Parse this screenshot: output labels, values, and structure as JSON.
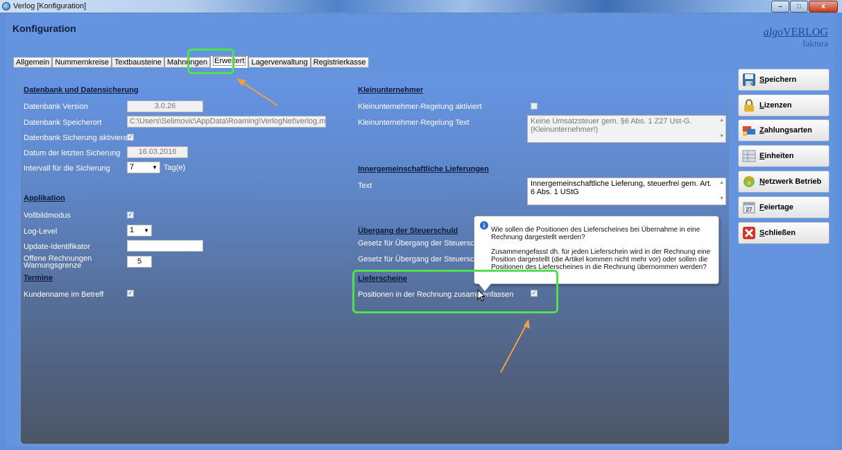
{
  "window": {
    "title": "Verlog [Konfiguration]",
    "min": "–",
    "max": "□",
    "close": "x"
  },
  "header": {
    "title": "Konfiguration",
    "brand_main": "algo",
    "brand_main2": "VERLOG",
    "brand_sub": "faktura"
  },
  "tabs": [
    "Allgemein",
    "Nummernkreise",
    "Textbausteine",
    "Mahnungen",
    "Erweitert",
    "Lagerverwaltung",
    "Registrierkasse"
  ],
  "left": {
    "db_section": "Datenbank und Datensicherung",
    "db_version_label": "Datenbank Version",
    "db_version_value": "3.0.26",
    "db_path_label": "Datenbank Speicherort",
    "db_path_value": "C:\\Users\\Selimovic\\AppData\\Roaming\\VerlogNet\\verlog.mdb",
    "backup_enable_label": "Datenbank Sicherung aktivieren",
    "last_backup_label": "Datum der letzten Sicherung",
    "last_backup_value": "16.03.2016",
    "interval_label": "Intervall für die Sicherung",
    "interval_value": "7",
    "interval_unit": "Tag(e)",
    "app_section": "Applikation",
    "fullscreen_label": "Vollbildmodus",
    "loglevel_label": "Log-Level",
    "loglevel_value": "1",
    "update_id_label": "Update-Identifikator",
    "update_id_value": "",
    "open_invoices_label_1": "Offene Rechnungen",
    "open_invoices_label_2": "Warnungsgrenze",
    "open_invoices_value": "5",
    "termine_section": "Termine",
    "customer_in_subject_label": "Kundenname im Betreff"
  },
  "right": {
    "klein_section": "Kleinunternehmer",
    "klein_active_label": "Kleinunternehmer-Regelung aktiviert",
    "klein_text_label": "Kleinunternehmer-Regelung Text",
    "klein_text_value": "Keine Umsatzsteuer gem. §6 Abs. 1 Z27 Ust-G. (Kleinunternehmer!)",
    "ig_section": "Innergemeinschaftliche Lieferungen",
    "ig_text_label": "Text",
    "ig_text_value": "Innergemeinschaftliche Lieferung, steuerfrei gem. Art. 6 Abs. 1 UStG",
    "steuer_section": "Übergang der Steuerschuld",
    "steuer_law1_label": "Gesetz für Übergang der Steuerschuld",
    "steuer_law2_label": "Gesetz für Übergang der Steuerschuld",
    "liefer_section": "Lieferscheine",
    "liefer_merge_label": "Positionen in der Rechnung zusammenfassen"
  },
  "tooltip": {
    "line1": "Wie sollen die Positionen des Lieferscheines bei Übernahme in eine Rechnung dargestellt werden?",
    "line2": "Zusammengefasst dh. für jeden Lieferschein wird in der Rechnung eine Position dargestellt (die Artikel kommen nicht mehr vor) oder sollen die Positionen des Lieferscheines in die Rechnung übernommen werden?"
  },
  "buttons": [
    {
      "key": "S",
      "rest": "peichern"
    },
    {
      "key": "L",
      "rest": "izenzen"
    },
    {
      "key": "Z",
      "rest": "ahlungsarten"
    },
    {
      "key": "E",
      "rest": "inheiten"
    },
    {
      "key": "N",
      "rest": "etzwerk Betrieb"
    },
    {
      "key": "F",
      "rest": "eiertage"
    },
    {
      "key": "S",
      "rest": "chließen"
    }
  ],
  "checkmarks": {
    "checked": "✓",
    "unchecked": ""
  },
  "colors": {
    "highlight": "#4fe24a",
    "arrow": "#f0a040"
  }
}
